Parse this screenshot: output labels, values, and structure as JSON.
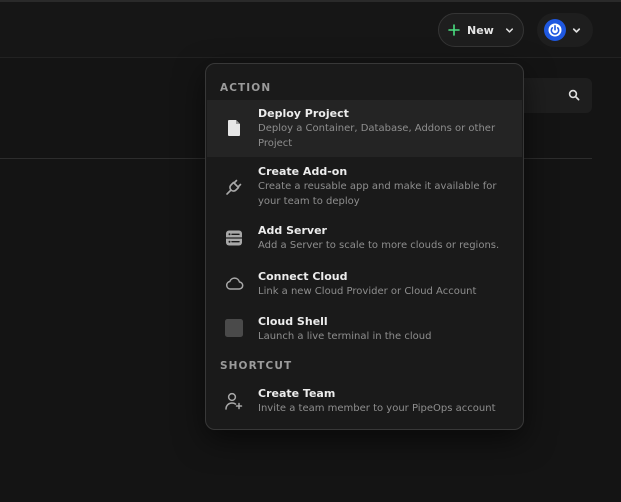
{
  "header": {
    "new_label": "New"
  },
  "menu": {
    "sections": {
      "action": "ACTION",
      "shortcut": "SHORTCUT"
    },
    "items": [
      {
        "title": "Deploy Project",
        "desc": "Deploy a Container, Database, Addons or other Project",
        "icon": "file-icon"
      },
      {
        "title": "Create Add-on",
        "desc": "Create a reusable app and make it available for your team to deploy",
        "icon": "plug-icon"
      },
      {
        "title": "Add Server",
        "desc": "Add a Server to scale to more clouds or regions.",
        "icon": "server-icon"
      },
      {
        "title": "Connect Cloud",
        "desc": "Link a new Cloud Provider or Cloud Account",
        "icon": "cloud-icon"
      },
      {
        "title": "Cloud Shell",
        "desc": "Launch a live terminal in the cloud",
        "icon": "terminal-icon"
      },
      {
        "title": "Create Team",
        "desc": "Invite a team member to your PipeOps account",
        "icon": "user-plus-icon"
      }
    ]
  },
  "colors": {
    "accent_green": "#4ade80",
    "avatar_blue": "#1f58e0",
    "background": "#141414",
    "menu_bg": "#1a1a1a"
  }
}
